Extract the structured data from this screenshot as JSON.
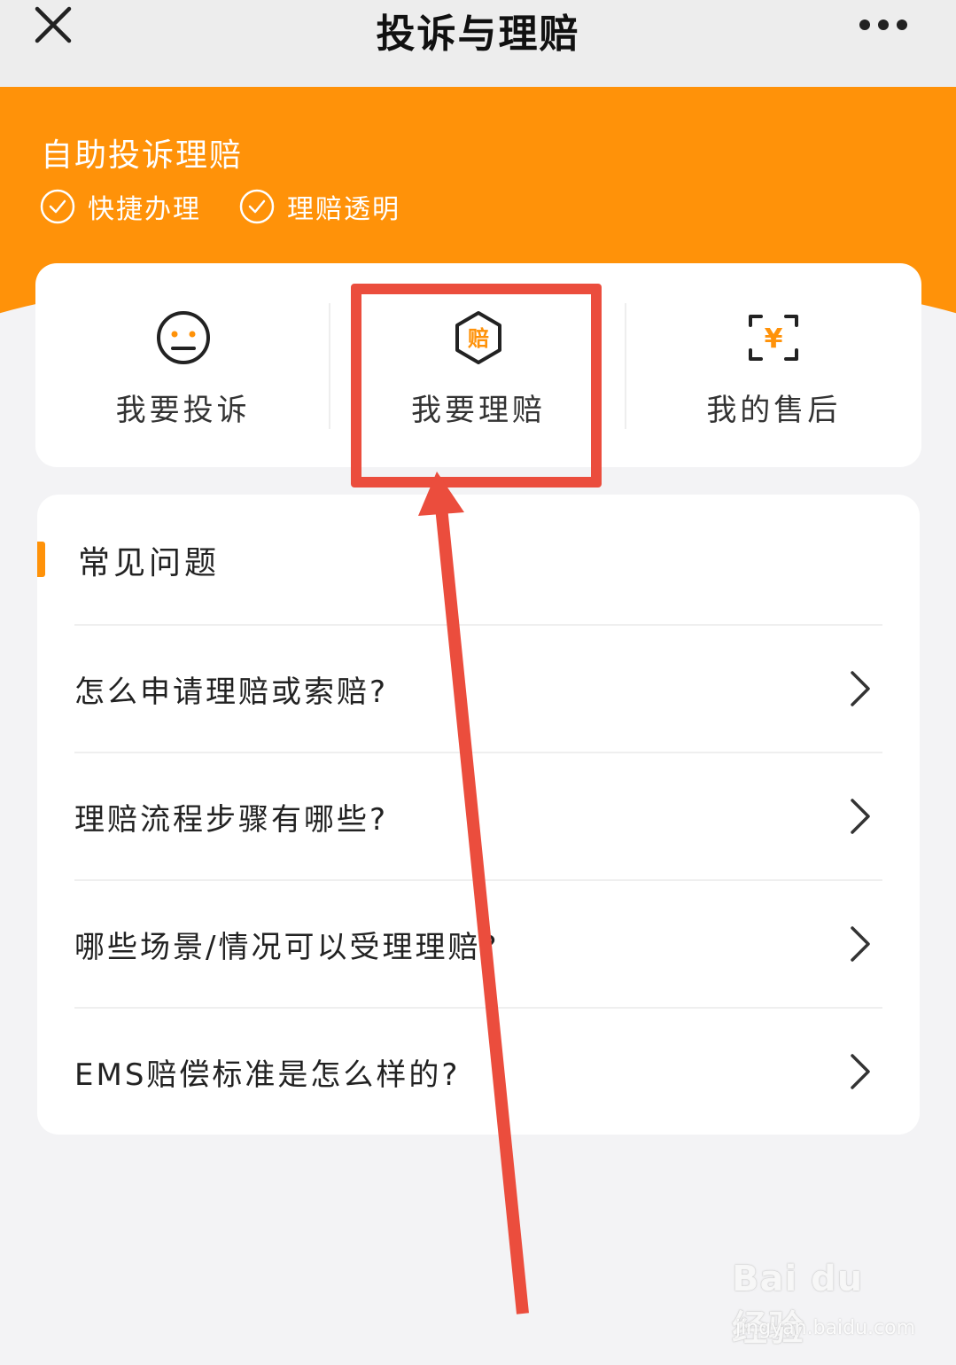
{
  "nav": {
    "title": "投诉与理赔",
    "close_icon": "close-icon",
    "more_icon": "more-dots-icon"
  },
  "hero": {
    "title": "自助投诉理赔",
    "features": [
      "快捷办理",
      "理赔透明"
    ]
  },
  "actions": [
    {
      "label": "我要投诉",
      "icon": "neutral-face-icon"
    },
    {
      "label": "我要理赔",
      "icon": "compensation-hexagon-icon",
      "icon_text": "赔"
    },
    {
      "label": "我的售后",
      "icon": "yuan-scan-icon",
      "icon_text": "¥"
    }
  ],
  "faq": {
    "title": "常见问题",
    "items": [
      "怎么申请理赔或索赔?",
      "理赔流程步骤有哪些?",
      "哪些场景/情况可以受理理赔?",
      "EMS赔偿标准是怎么样的?"
    ]
  },
  "watermark": {
    "logo": "Bai du 经验",
    "url": "jingyan.baidu.com"
  },
  "colors": {
    "accent": "#ff9209",
    "annotation": "#eb4d3d",
    "background": "#f3f3f5"
  }
}
